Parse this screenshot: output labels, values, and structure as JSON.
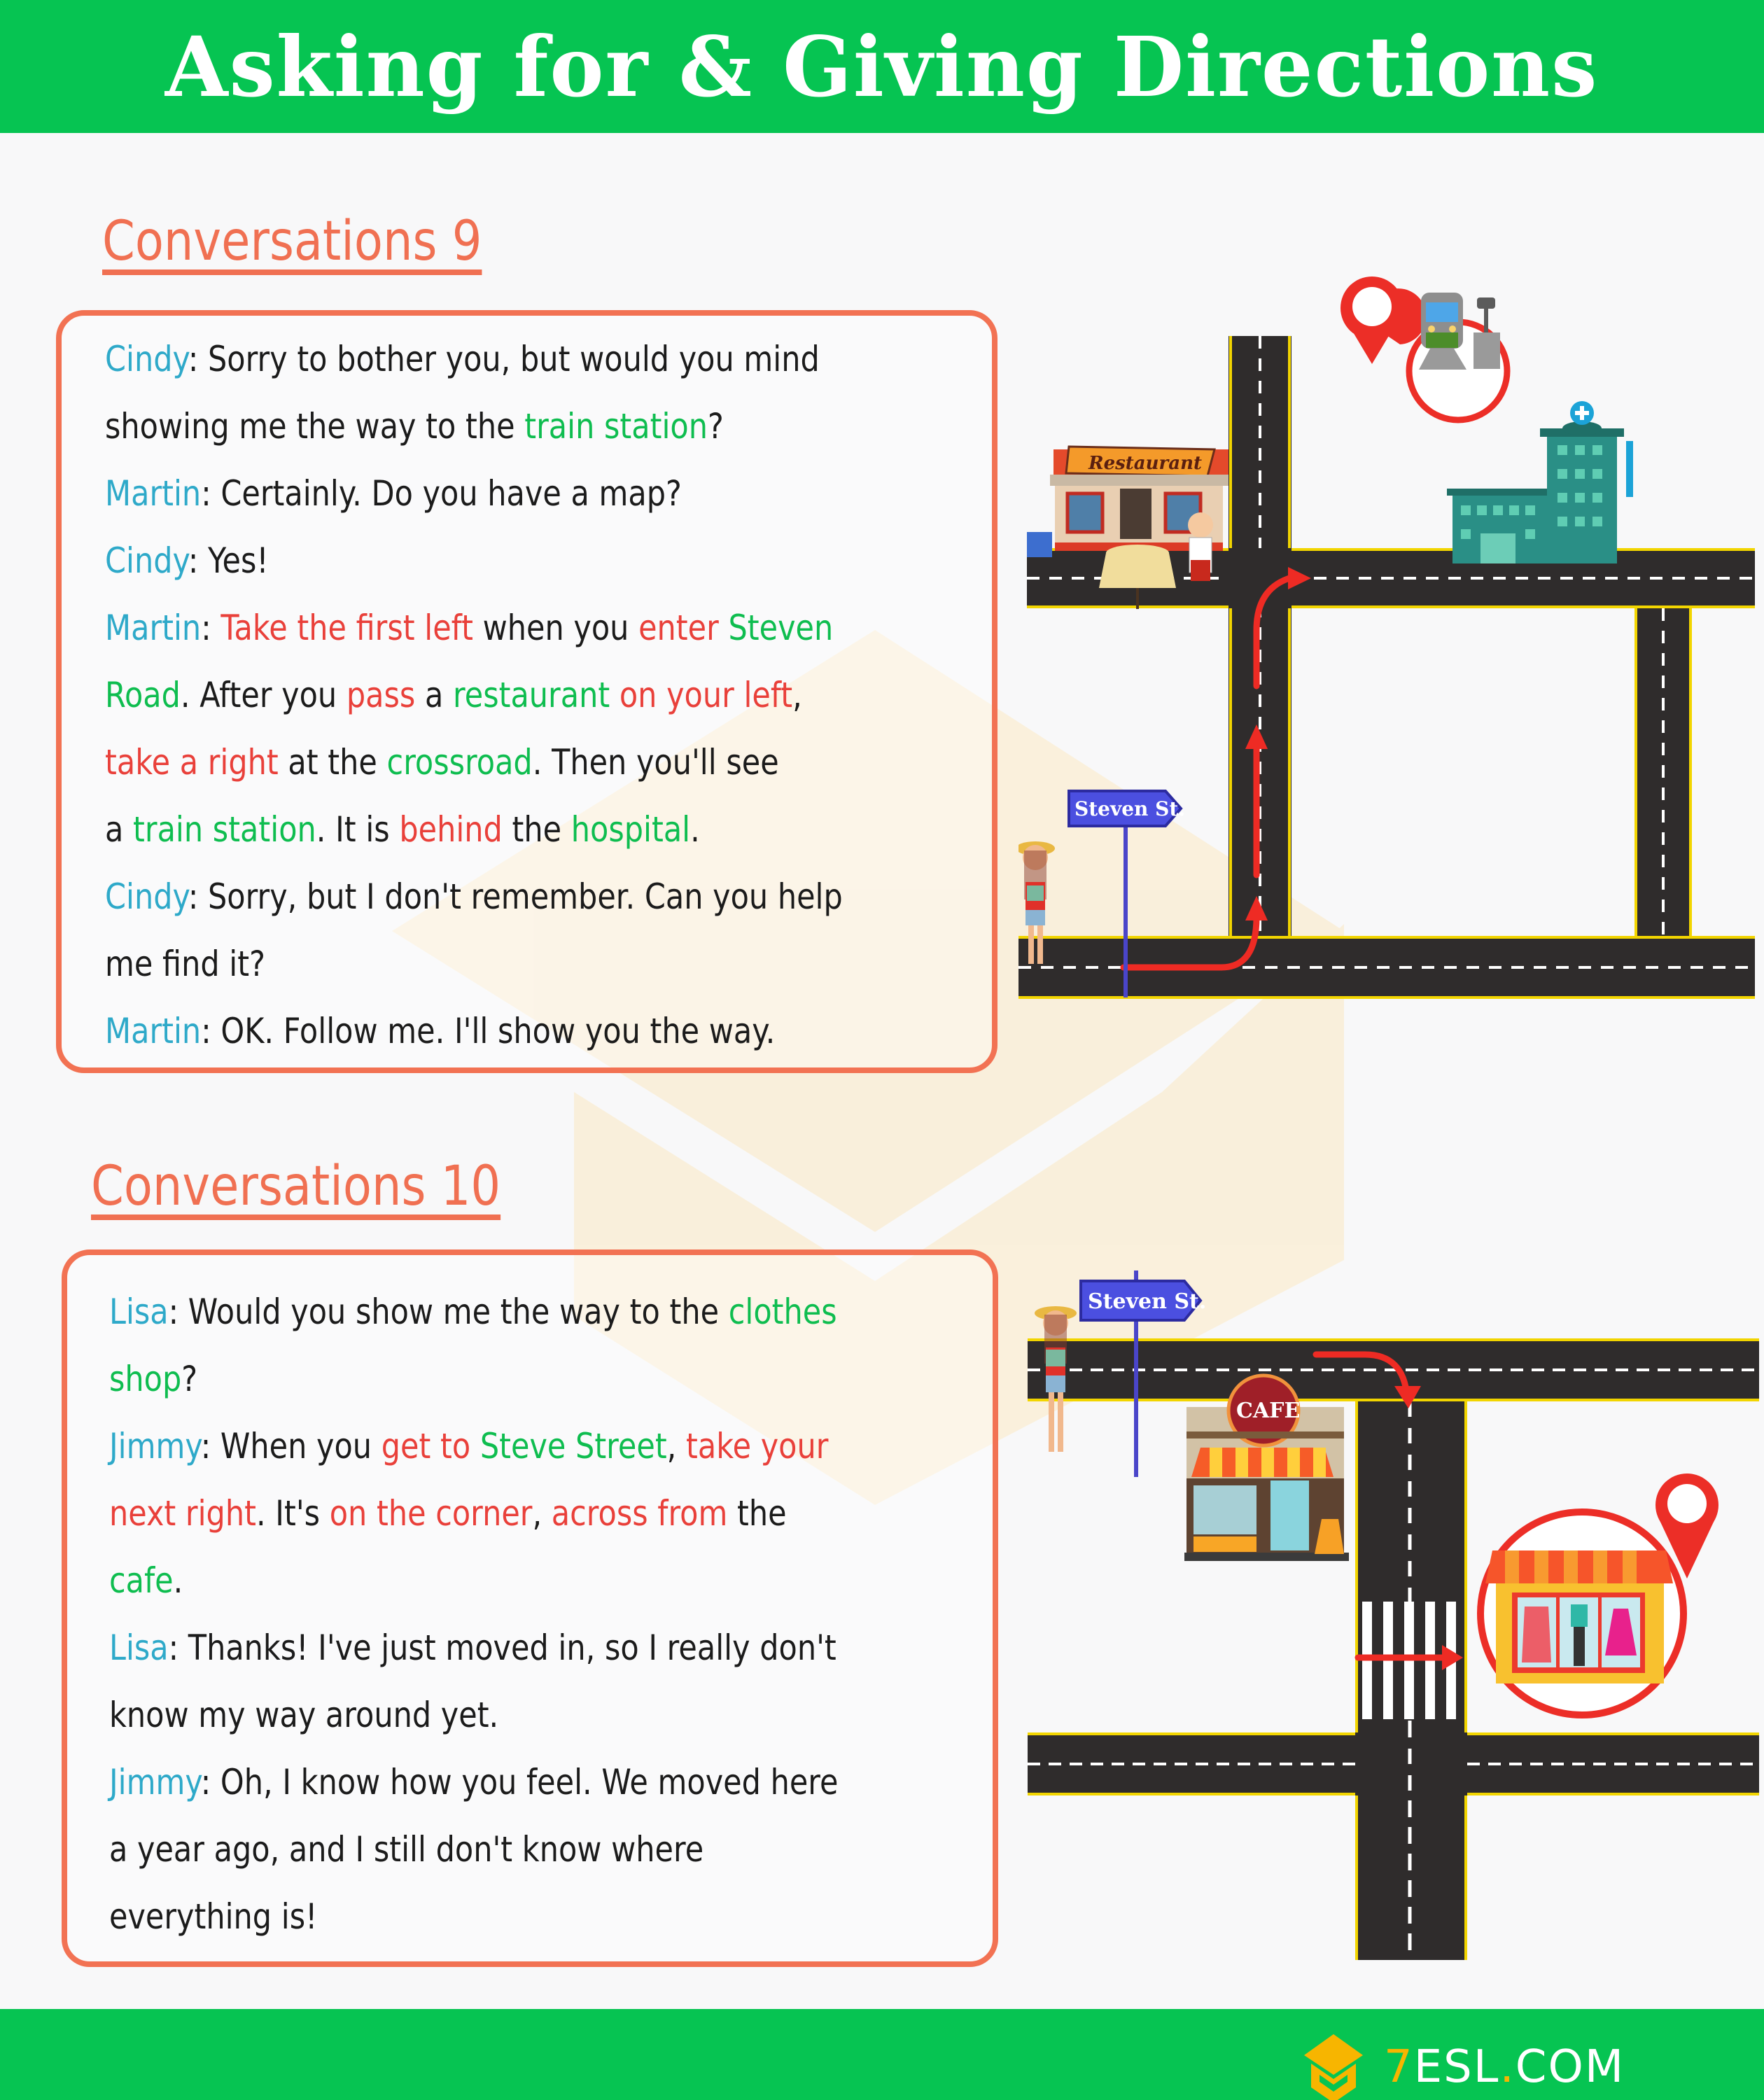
{
  "header": {
    "title": "Asking for & Giving Directions"
  },
  "colors": {
    "brand_green": "#06c452",
    "title_orange": "#f07052",
    "box_border": "#f27253",
    "speaker": "#2ea9c9",
    "keyword_red": "#e9403a",
    "place_green": "#0ebd4f",
    "logo_yellow": "#f7b500"
  },
  "conversation9": {
    "title": "Conversations 9",
    "lines": [
      [
        [
          "sp",
          "Cindy"
        ],
        [
          "tx",
          ": Sorry to bother you, but would you mind"
        ]
      ],
      [
        [
          "tx",
          "showing me the way to the "
        ],
        [
          "pl",
          "train station"
        ],
        [
          "tx",
          "?"
        ]
      ],
      [
        [
          "sp",
          "Martin"
        ],
        [
          "tx",
          ": Certainly. Do you have a map?"
        ]
      ],
      [
        [
          "sp",
          "Cindy"
        ],
        [
          "tx",
          ": Yes!"
        ]
      ],
      [
        [
          "sp",
          "Martin"
        ],
        [
          "tx",
          ": "
        ],
        [
          "kw",
          "Take the first left"
        ],
        [
          "tx",
          " when you "
        ],
        [
          "kw",
          "enter "
        ],
        [
          "pl",
          "Steven"
        ]
      ],
      [
        [
          "pl",
          "Road"
        ],
        [
          "tx",
          ". After you "
        ],
        [
          "kw",
          "pass"
        ],
        [
          "tx",
          " a "
        ],
        [
          "pl",
          "restaurant"
        ],
        [
          "kw",
          " on your left"
        ],
        [
          "tx",
          ","
        ]
      ],
      [
        [
          "kw",
          "take a right"
        ],
        [
          "tx",
          " at the "
        ],
        [
          "pl",
          "crossroad"
        ],
        [
          "tx",
          ". Then you'll see"
        ]
      ],
      [
        [
          "tx",
          "a "
        ],
        [
          "pl",
          "train station"
        ],
        [
          "tx",
          ". It is "
        ],
        [
          "kw",
          "behind"
        ],
        [
          "tx",
          " the "
        ],
        [
          "pl",
          "hospital"
        ],
        [
          "tx",
          "."
        ]
      ],
      [
        [
          "sp",
          "Cindy"
        ],
        [
          "tx",
          ": Sorry, but I don't remember. Can you help"
        ]
      ],
      [
        [
          "tx",
          "me find it?"
        ]
      ],
      [
        [
          "sp",
          "Martin"
        ],
        [
          "tx",
          ": OK. Follow me. I'll show you the way."
        ]
      ]
    ],
    "map": {
      "street_sign": "Steven St.",
      "restaurant_sign": "Restaurant",
      "destination": "train station",
      "landmark": "hospital"
    }
  },
  "conversation10": {
    "title": "Conversations 10",
    "lines": [
      [
        [
          "sp",
          "Lisa"
        ],
        [
          "tx",
          ": Would you show me the way to the "
        ],
        [
          "pl",
          "clothes"
        ]
      ],
      [
        [
          "pl",
          "shop"
        ],
        [
          "tx",
          "?"
        ]
      ],
      [
        [
          "sp",
          "Jimmy"
        ],
        [
          "tx",
          ": When you "
        ],
        [
          "kw",
          "get to "
        ],
        [
          "pl",
          "Steve Street"
        ],
        [
          "tx",
          ", "
        ],
        [
          "kw",
          "take your"
        ]
      ],
      [
        [
          "kw",
          "next right"
        ],
        [
          "tx",
          ". It's "
        ],
        [
          "kw",
          "on the corner"
        ],
        [
          "tx",
          ", "
        ],
        [
          "kw",
          "across from"
        ],
        [
          "tx",
          " the"
        ]
      ],
      [
        [
          "pl",
          "cafe"
        ],
        [
          "tx",
          "."
        ]
      ],
      [
        [
          "sp",
          "Lisa"
        ],
        [
          "tx",
          ": Thanks! I've just moved in, so I really don't"
        ]
      ],
      [
        [
          "tx",
          "know my way around yet."
        ]
      ],
      [
        [
          "sp",
          "Jimmy"
        ],
        [
          "tx",
          ": Oh, I know how you feel. We moved here"
        ]
      ],
      [
        [
          "tx",
          "a year ago, and I still don't know where"
        ]
      ],
      [
        [
          "tx",
          "everything is!"
        ]
      ]
    ],
    "map": {
      "street_sign": "Steven St.",
      "cafe_sign": "CAFE",
      "destination": "clothes shop"
    }
  },
  "footer": {
    "logo_seven": "7",
    "logo_main": "ESL",
    "logo_dot": ".",
    "logo_tld": "COM"
  }
}
